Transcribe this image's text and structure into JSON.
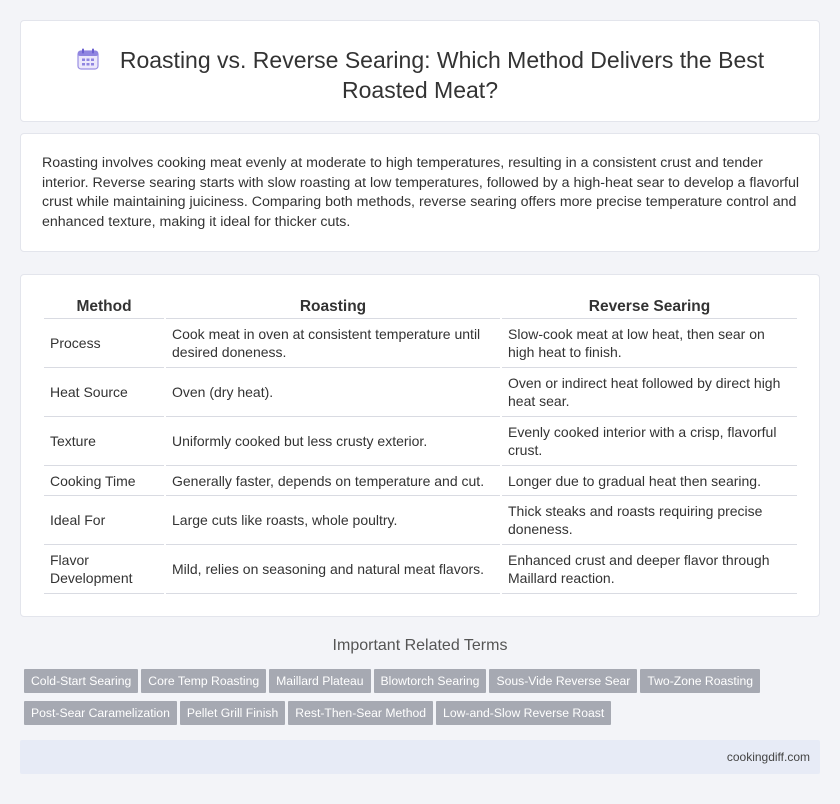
{
  "header": {
    "title": "Roasting vs. Reverse Searing: Which Method Delivers the Best Roasted Meat?",
    "icon": "calendar-icon"
  },
  "intro": {
    "text": "Roasting involves cooking meat evenly at moderate to high temperatures, resulting in a consistent crust and tender interior. Reverse searing starts with slow roasting at low temperatures, followed by a high-heat sear to develop a flavorful crust while maintaining juiciness. Comparing both methods, reverse searing offers more precise temperature control and enhanced texture, making it ideal for thicker cuts."
  },
  "table": {
    "headers": [
      "Method",
      "Roasting",
      "Reverse Searing"
    ],
    "rows": [
      [
        "Process",
        "Cook meat in oven at consistent temperature until desired doneness.",
        "Slow-cook meat at low heat, then sear on high heat to finish."
      ],
      [
        "Heat Source",
        "Oven (dry heat).",
        "Oven or indirect heat followed by direct high heat sear."
      ],
      [
        "Texture",
        "Uniformly cooked but less crusty exterior.",
        "Evenly cooked interior with a crisp, flavorful crust."
      ],
      [
        "Cooking Time",
        "Generally faster, depends on temperature and cut.",
        "Longer due to gradual heat then searing."
      ],
      [
        "Ideal For",
        "Large cuts like roasts, whole poultry.",
        "Thick steaks and roasts requiring precise doneness."
      ],
      [
        "Flavor Development",
        "Mild, relies on seasoning and natural meat flavors.",
        "Enhanced crust and deeper flavor through Maillard reaction."
      ]
    ]
  },
  "related": {
    "title": "Important Related Terms",
    "tags": [
      "Cold-Start Searing",
      "Core Temp Roasting",
      "Maillard Plateau",
      "Blowtorch Searing",
      "Sous-Vide Reverse Sear",
      "Two-Zone Roasting",
      "Post-Sear Caramelization",
      "Pellet Grill Finish",
      "Rest-Then-Sear Method",
      "Low-and-Slow Reverse Roast"
    ]
  },
  "footer": {
    "site": "cookingdiff.com"
  },
  "colors": {
    "background": "#f3f4f8",
    "tag": "#a6a9b2",
    "footer": "#e7ebf6",
    "icon_accent": "#7b6fd6"
  }
}
